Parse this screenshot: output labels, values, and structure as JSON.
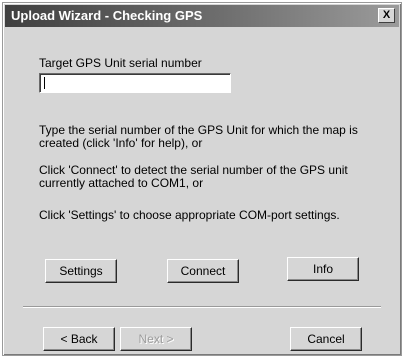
{
  "window": {
    "title": "Upload Wizard - Checking GPS",
    "close_label": "X"
  },
  "serial": {
    "label": "Target GPS Unit serial number",
    "value": ""
  },
  "instructions": {
    "line1": "Type the serial number of the GPS Unit for which the map is",
    "line2": "created (click 'Info' for help), or",
    "line3": "Click 'Connect' to detect the serial number of the GPS unit",
    "line4": "currently attached to COM1, or",
    "line5": "Click 'Settings' to choose appropriate COM-port settings."
  },
  "actions": {
    "settings": "Settings",
    "connect": "Connect",
    "info": "Info"
  },
  "navigation": {
    "back": "< Back",
    "next": "Next >",
    "cancel": "Cancel"
  }
}
